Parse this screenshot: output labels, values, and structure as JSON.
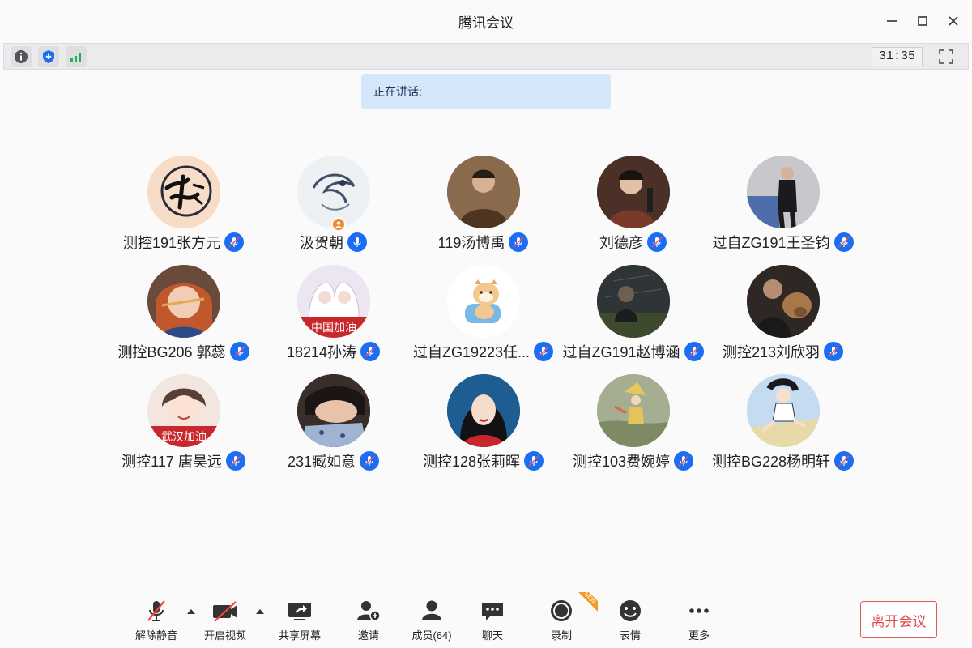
{
  "window": {
    "title": "腾讯会议"
  },
  "infobar": {
    "timer": "31:35",
    "icons": [
      "info-icon",
      "shield-icon",
      "signal-icon"
    ]
  },
  "speaking": {
    "label": "正在讲话:"
  },
  "participants": [
    {
      "name": "测控191张方元",
      "mic": "muted",
      "avatar": "calligraphy"
    },
    {
      "name": "汲贺朝",
      "mic": "active",
      "avatar": "ink-wash",
      "host": true
    },
    {
      "name": "119汤博禹",
      "mic": "muted",
      "avatar": "photo-brown"
    },
    {
      "name": "刘德彦",
      "mic": "muted",
      "avatar": "photo-dark"
    },
    {
      "name": "过自ZG191王圣钧",
      "mic": "muted",
      "avatar": "photo-grey"
    },
    {
      "name": "测控BG206 郭蕊",
      "mic": "muted",
      "avatar": "photo-redhair"
    },
    {
      "name": "18214孙涛",
      "mic": "muted",
      "avatar": "anime-white",
      "overlay_text": "中国加油"
    },
    {
      "name": "过自ZG19223任...",
      "mic": "muted",
      "avatar": "cartoon-dog"
    },
    {
      "name": "过自ZG191赵博涵",
      "mic": "muted",
      "avatar": "photo-night"
    },
    {
      "name": "测控213刘欣羽",
      "mic": "muted",
      "avatar": "photo-dog"
    },
    {
      "name": "测控117 唐昊远",
      "mic": "muted",
      "avatar": "anime-boy",
      "overlay_text": "武汉加油"
    },
    {
      "name": "231臧如意",
      "mic": "muted",
      "avatar": "anime-sleep"
    },
    {
      "name": "测控128张莉晖",
      "mic": "muted",
      "avatar": "anime-girl"
    },
    {
      "name": "测控103费婉婷",
      "mic": "muted",
      "avatar": "painting"
    },
    {
      "name": "测控BG228杨明轩",
      "mic": "muted",
      "avatar": "anime-sky"
    }
  ],
  "toolbar": {
    "unmute": "解除静音",
    "start_video": "开启视频",
    "share_screen": "共享屏幕",
    "invite": "邀请",
    "members": "成员(64)",
    "chat": "聊天",
    "record": "录制",
    "record_badge": "NEW",
    "reactions": "表情",
    "more": "更多",
    "leave": "离开会议"
  },
  "colors": {
    "accent": "#1b6ef3",
    "leave": "#e04545",
    "banner": "#d6e6fb",
    "host_badge": "#f08a24"
  }
}
